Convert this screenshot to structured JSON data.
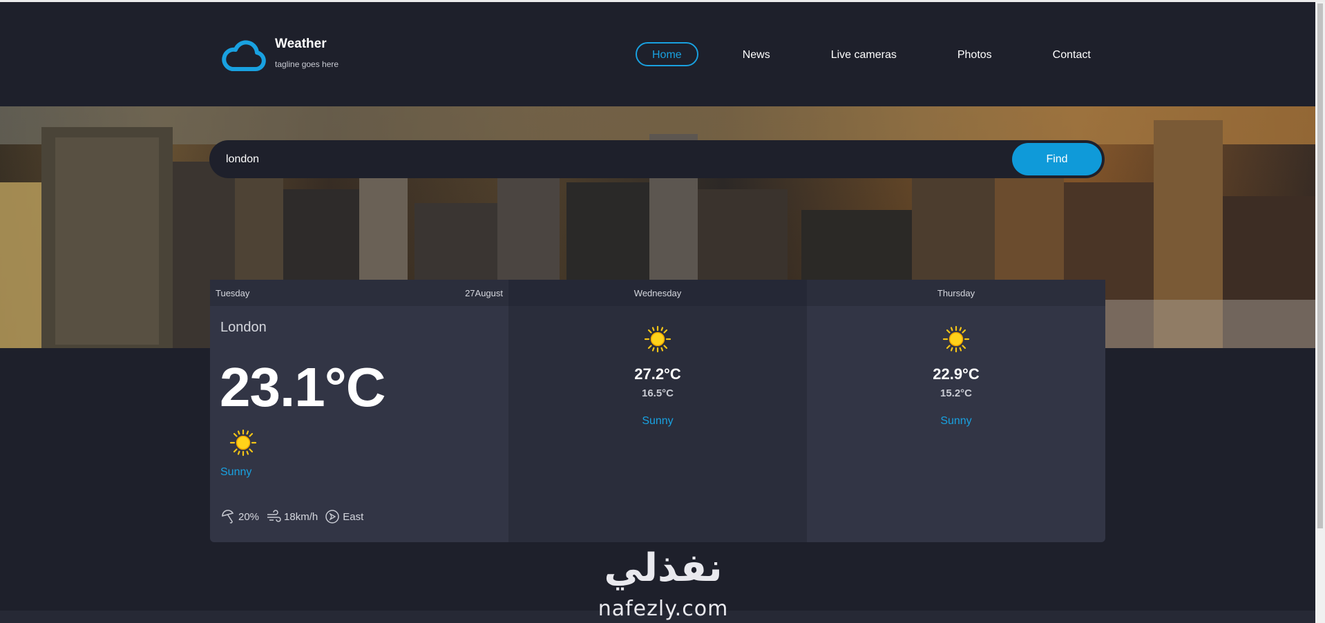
{
  "header": {
    "site_title": "Weather",
    "tagline": "tagline goes here",
    "nav": [
      {
        "label": "Home",
        "active": true
      },
      {
        "label": "News",
        "active": false
      },
      {
        "label": "Live cameras",
        "active": false
      },
      {
        "label": "Photos",
        "active": false
      },
      {
        "label": "Contact",
        "active": false
      }
    ]
  },
  "search": {
    "value": "london",
    "button_label": "Find"
  },
  "forecast": {
    "today": {
      "day": "Tuesday",
      "date": "27August",
      "location": "London",
      "temperature": "23.1°C",
      "icon": "sun-icon",
      "condition": "Sunny",
      "precipitation": "20%",
      "wind_speed": "18km/h",
      "wind_direction": "East"
    },
    "days": [
      {
        "day": "Wednesday",
        "icon": "sun-icon",
        "max": "27.2°C",
        "min": "16.5°C",
        "condition": "Sunny"
      },
      {
        "day": "Thursday",
        "icon": "sun-icon",
        "max": "22.9°C",
        "min": "15.2°C",
        "condition": "Sunny"
      }
    ]
  },
  "watermark": {
    "arabic": "نفذلي",
    "latin": "nafezly.com"
  },
  "colors": {
    "background": "#1e202b",
    "accent": "#19a1e0",
    "button": "#0f9ad9",
    "card": "#323545",
    "sun": "#f5c518"
  }
}
